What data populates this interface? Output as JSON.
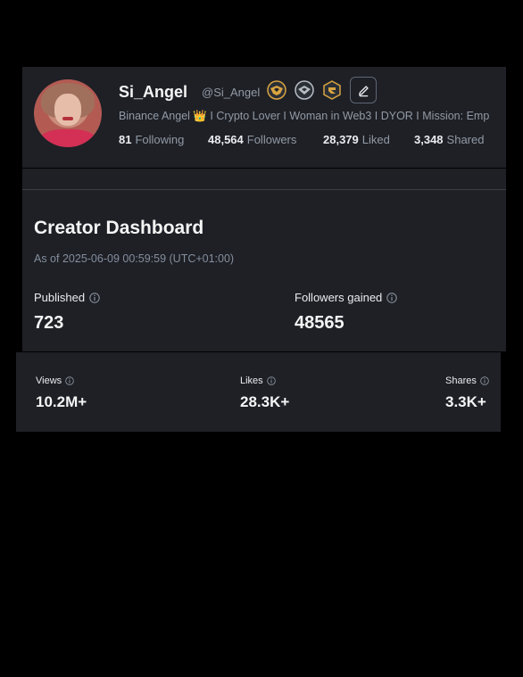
{
  "profile": {
    "name": "Si_Angel",
    "handle": "@Si_Angel",
    "bio": "Binance Angel 👑 I Crypto Lover I Woman in Web3 I DYOR I Mission: Emp",
    "badges": [
      "binance-angel-badge-icon",
      "shield-badge-icon",
      "gold-badge-icon"
    ],
    "stats": {
      "following_count": "81",
      "following_label": "Following",
      "followers_count": "48,564",
      "followers_label": "Followers",
      "liked_count": "28,379",
      "liked_label": "Liked",
      "shared_count": "3,348",
      "shared_label": "Shared"
    }
  },
  "dashboard": {
    "title": "Creator Dashboard",
    "as_of": "As of 2025-06-09 00:59:59 (UTC+01:00)",
    "published_label": "Published",
    "published_value": "723",
    "followers_gained_label": "Followers gained",
    "followers_gained_value": "48565"
  },
  "strip": {
    "views_label": "Views",
    "views_value": "10.2M+",
    "likes_label": "Likes",
    "likes_value": "28.3K+",
    "shares_label": "Shares",
    "shares_value": "3.3K+"
  },
  "colors": {
    "background": "#000000",
    "card": "#1e2026",
    "text_primary": "#eaecef",
    "text_secondary": "#929aa5",
    "badge_gold": "#d9a441"
  }
}
